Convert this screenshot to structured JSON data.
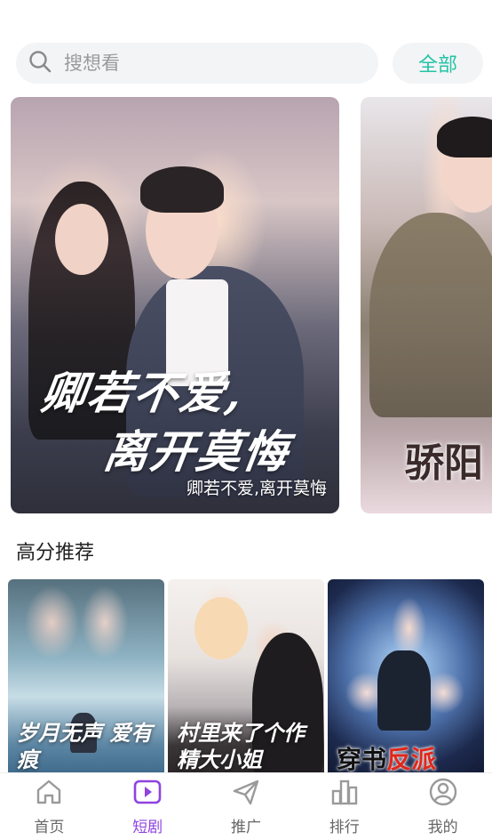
{
  "search": {
    "placeholder": "搜想看",
    "all_label": "全部"
  },
  "banner": {
    "items": [
      {
        "poster_line1": "卿若不爱,",
        "poster_line2": "离开莫悔",
        "title": "卿若不爱,离开莫悔"
      },
      {
        "poster_text": "骄阳"
      }
    ]
  },
  "section": {
    "title": "高分推荐",
    "items": [
      {
        "poster_text": "岁月无声 爱有痕"
      },
      {
        "poster_text": "村里来了个作精大小姐"
      },
      {
        "poster_text_a": "穿书",
        "poster_text_b": "反派"
      }
    ]
  },
  "nav": {
    "items": [
      {
        "label": "首页",
        "icon": "home-icon"
      },
      {
        "label": "短剧",
        "icon": "video-play-icon",
        "active": true
      },
      {
        "label": "推广",
        "icon": "paper-plane-icon"
      },
      {
        "label": "排行",
        "icon": "bar-chart-icon"
      },
      {
        "label": "我的",
        "icon": "profile-icon"
      }
    ],
    "active_color": "#8f43e0",
    "inactive_color": "#999999"
  },
  "accent_color": "#24c3a6"
}
